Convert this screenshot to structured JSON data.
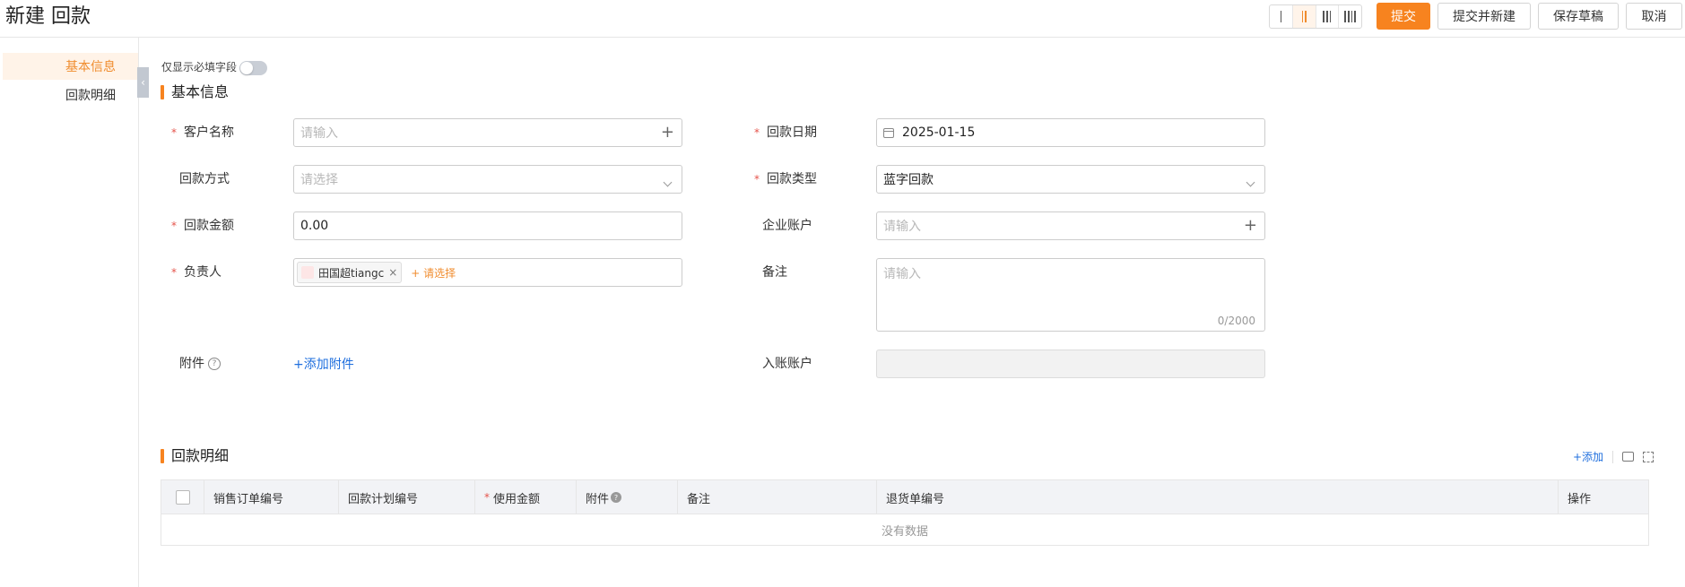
{
  "header": {
    "title": "新建 回款",
    "column_options": [
      "one-column-icon",
      "two-column-icon",
      "three-column-icon",
      "four-column-icon"
    ],
    "buttons": {
      "submit": "提交",
      "submit_new": "提交并新建",
      "save_draft": "保存草稿",
      "cancel": "取消"
    }
  },
  "sidebar": {
    "items": [
      {
        "label": "基本信息",
        "active": true
      },
      {
        "label": "回款明细",
        "active": false
      }
    ]
  },
  "toggle": {
    "label": "仅显示必填字段",
    "on": false
  },
  "basic": {
    "title": "基本信息",
    "customer": {
      "label": "客户名称",
      "placeholder": "请输入"
    },
    "pay_method": {
      "label": "回款方式",
      "placeholder": "请选择"
    },
    "amount": {
      "label": "回款金额",
      "value": "0.00"
    },
    "owner": {
      "label": "负责人",
      "tag": "田国超tiangc",
      "avatar_text": "头像",
      "add_label": "+ 请选择"
    },
    "attachment": {
      "label": "附件",
      "add_label": "+添加附件"
    },
    "pay_date": {
      "label": "回款日期",
      "value": "2025-01-15"
    },
    "pay_type": {
      "label": "回款类型",
      "value": "蓝字回款"
    },
    "company_account": {
      "label": "企业账户",
      "placeholder": "请输入"
    },
    "remark": {
      "label": "备注",
      "placeholder": "请输入",
      "counter": "0/2000"
    },
    "entry_account": {
      "label": "入账账户"
    }
  },
  "detail": {
    "title": "回款明细",
    "add_label": "+添加",
    "columns": [
      "销售订单编号",
      "回款计划编号",
      "使用金额",
      "附件",
      "备注",
      "退货单编号",
      "操作"
    ],
    "empty_text": "没有数据"
  },
  "colors": {
    "accent": "#f7831f",
    "link": "#1f6fde",
    "required": "#e5534b"
  }
}
